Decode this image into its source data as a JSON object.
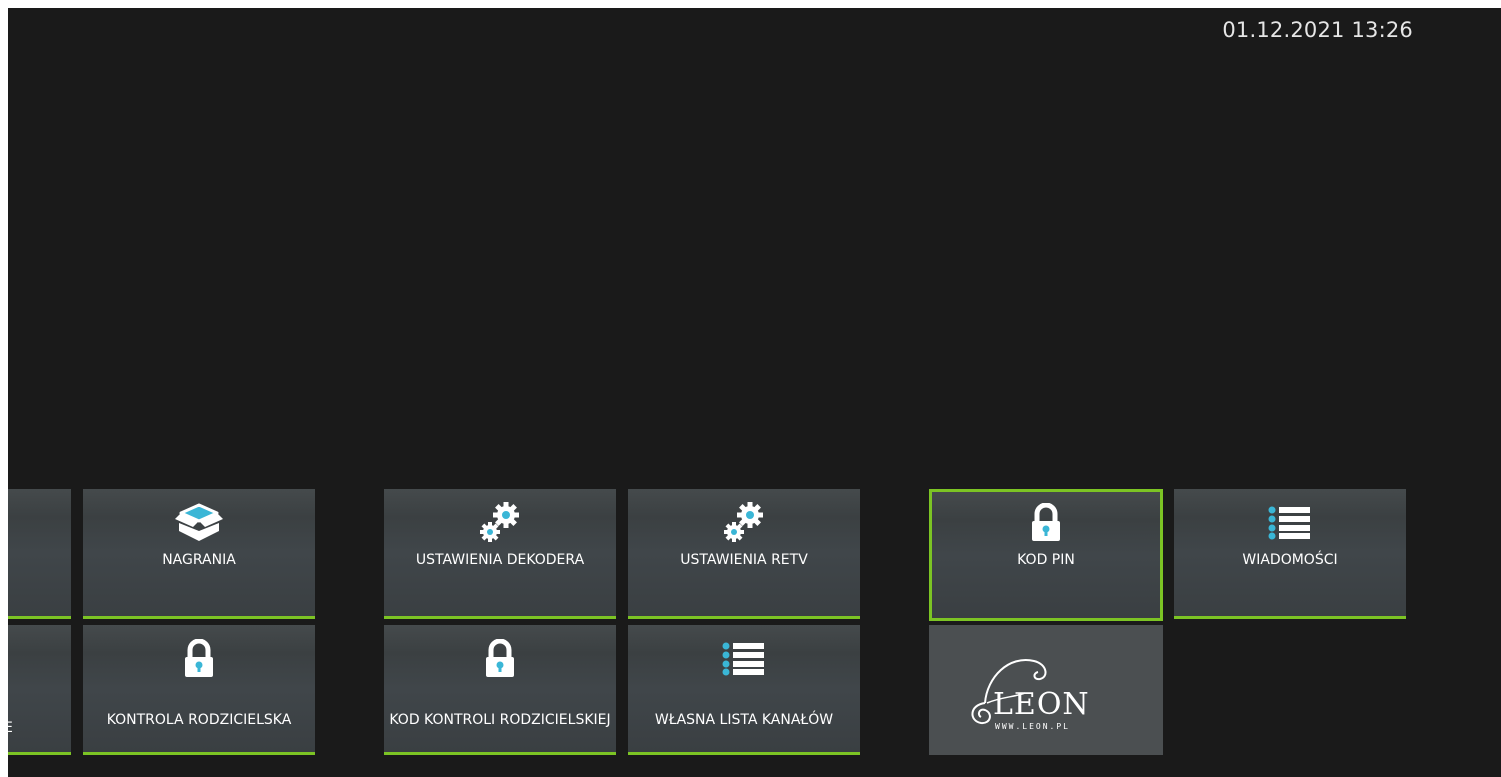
{
  "header": {
    "datetime": "01.12.2021 13:26"
  },
  "colors": {
    "accent_green": "#7cc424",
    "icon_blue": "#3ab6d6",
    "background": "#1a1a1a"
  },
  "tiles": [
    {
      "id": "partial-top",
      "label": "",
      "icon": "none"
    },
    {
      "id": "nagrania",
      "label": "NAGRANIA",
      "icon": "box-icon"
    },
    {
      "id": "ustawienia-dekodera",
      "label": "USTAWIENIA DEKODERA",
      "icon": "gears-icon"
    },
    {
      "id": "ustawienia-retv",
      "label": "USTAWIENIA RETV",
      "icon": "gears-icon"
    },
    {
      "id": "kod-pin",
      "label": "KOD PIN",
      "icon": "lock-icon",
      "focused": true
    },
    {
      "id": "wiadomosci",
      "label": "WIADOMOŚCI",
      "icon": "list-icon"
    },
    {
      "id": "partial-bottom",
      "label": "E",
      "icon": "none"
    },
    {
      "id": "kontrola-rodzicielska",
      "label": "KONTROLA RODZICIELSKA",
      "icon": "lock-icon"
    },
    {
      "id": "kod-kontroli-rodzicielskiej",
      "label": "KOD KONTROLI RODZICIELSKIEJ",
      "icon": "lock-icon"
    },
    {
      "id": "wlasna-lista-kanalow",
      "label": "WŁASNA LISTA KANAŁÓW",
      "icon": "list-icon"
    },
    {
      "id": "leon-logo",
      "label": "",
      "icon": "leon-logo"
    }
  ],
  "logo": {
    "brand": "LEON",
    "url": "WWW.LEON.PL"
  }
}
